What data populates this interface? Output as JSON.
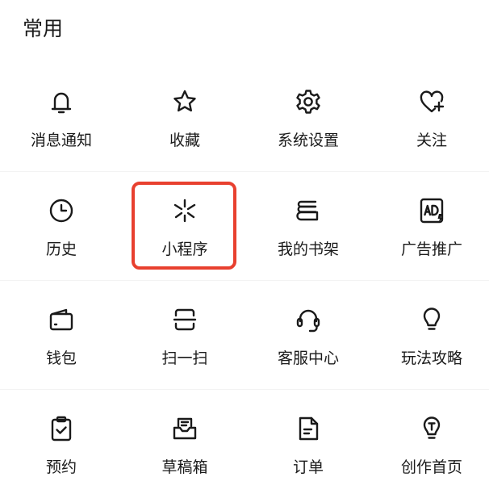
{
  "section": {
    "title": "常用"
  },
  "highlight": {
    "color": "#e8402f",
    "item": "小程序"
  },
  "items": [
    {
      "label": "消息通知",
      "icon": "bell-icon"
    },
    {
      "label": "收藏",
      "icon": "star-icon"
    },
    {
      "label": "系统设置",
      "icon": "gear-icon"
    },
    {
      "label": "关注",
      "icon": "heart-plus-icon"
    },
    {
      "label": "历史",
      "icon": "clock-icon"
    },
    {
      "label": "小程序",
      "icon": "mini-program-icon"
    },
    {
      "label": "我的书架",
      "icon": "bookshelf-icon"
    },
    {
      "label": "广告推广",
      "icon": "ad-icon"
    },
    {
      "label": "钱包",
      "icon": "wallet-icon"
    },
    {
      "label": "扫一扫",
      "icon": "scan-icon"
    },
    {
      "label": "客服中心",
      "icon": "headset-icon"
    },
    {
      "label": "玩法攻略",
      "icon": "lightbulb-icon"
    },
    {
      "label": "预约",
      "icon": "clipboard-check-icon"
    },
    {
      "label": "草稿箱",
      "icon": "drafts-icon"
    },
    {
      "label": "订单",
      "icon": "order-document-icon"
    },
    {
      "label": "创作首页",
      "icon": "creator-bulb-icon"
    }
  ]
}
